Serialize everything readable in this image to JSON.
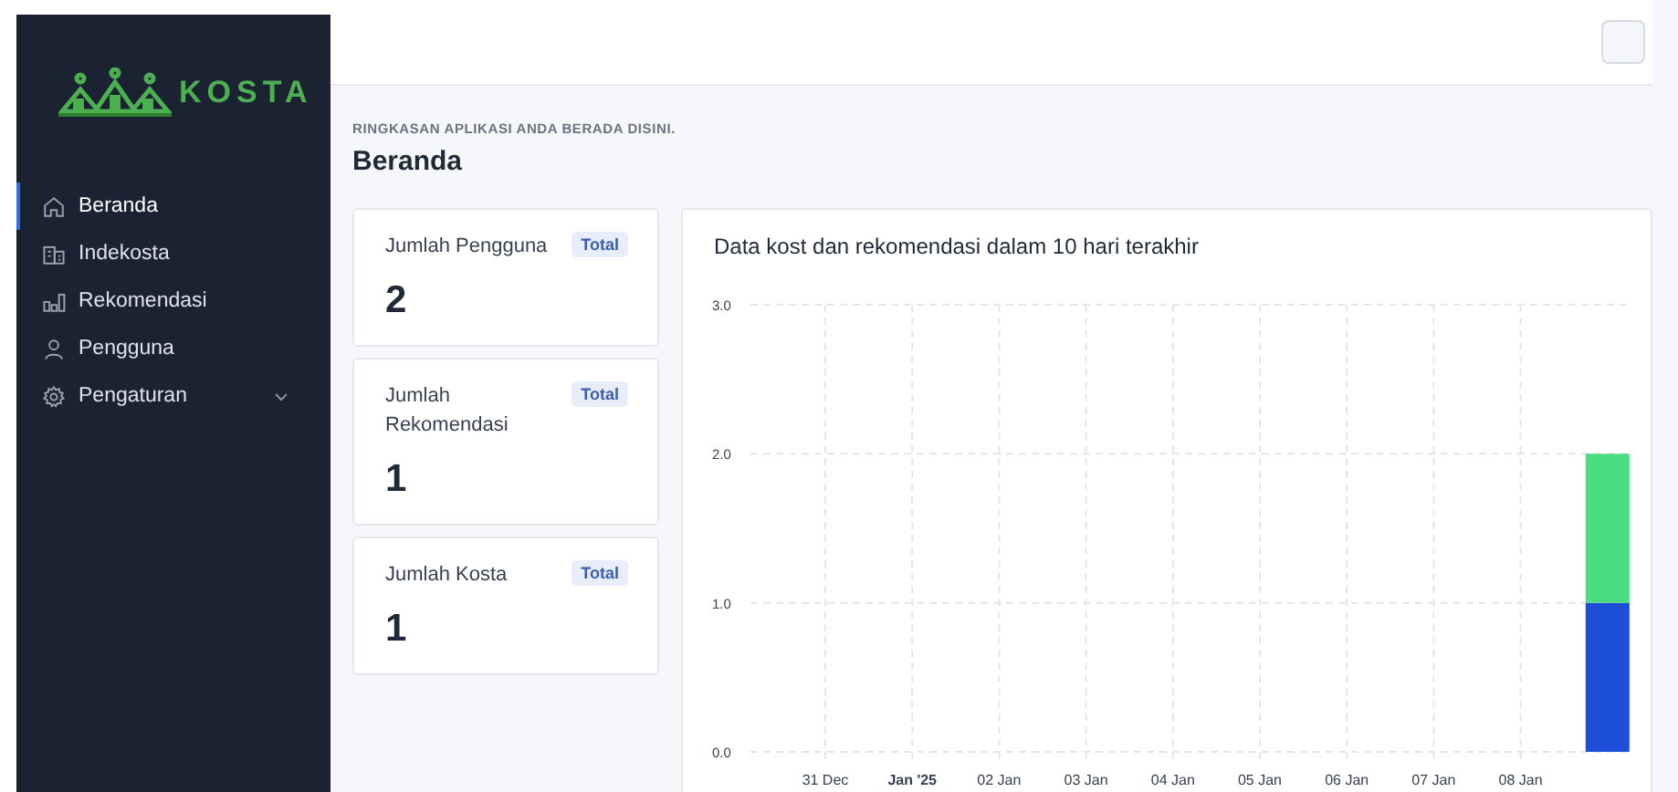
{
  "sidebar": {
    "logo_text": "KOSTA",
    "items": [
      {
        "label": "Beranda",
        "selected": true
      },
      {
        "label": "Indekosta",
        "selected": false
      },
      {
        "label": "Rekomendasi",
        "selected": false
      },
      {
        "label": "Pengguna",
        "selected": false
      },
      {
        "label": "Pengaturan",
        "selected": false,
        "expandable": true
      }
    ]
  },
  "page": {
    "subtitle": "RINGKASAN APLIKASI ANDA BERADA DISINI.",
    "title": "Beranda"
  },
  "stats": [
    {
      "label": "Jumlah Pengguna",
      "badge": "Total",
      "value": "2"
    },
    {
      "label": "Jumlah Rekomendasi",
      "badge": "Total",
      "value": "1"
    },
    {
      "label": "Jumlah Kosta",
      "badge": "Total",
      "value": "1"
    }
  ],
  "chart": {
    "title": "Data kost dan rekomendasi dalam 10 hari terakhir",
    "chart_data": {
      "type": "bar",
      "stacked": true,
      "grid": true,
      "categories": [
        "31 Dec",
        "Jan '25",
        "02 Jan",
        "03 Jan",
        "04 Jan",
        "05 Jan",
        "06 Jan",
        "07 Jan",
        "08 Jan",
        null
      ],
      "ylim": [
        0,
        3
      ],
      "yticks": [
        {
          "value": 0,
          "label": "0.0"
        },
        {
          "value": 1,
          "label": "1.0"
        },
        {
          "value": 2,
          "label": "2.0"
        },
        {
          "value": 3,
          "label": "3.0"
        }
      ],
      "series": [
        {
          "color": "#1d4ed8",
          "values": [
            0,
            0,
            0,
            0,
            0,
            0,
            0,
            0,
            0,
            1
          ]
        },
        {
          "color": "#4ade80",
          "values": [
            0,
            0,
            0,
            0,
            0,
            0,
            0,
            0,
            0,
            1
          ]
        }
      ]
    }
  }
}
